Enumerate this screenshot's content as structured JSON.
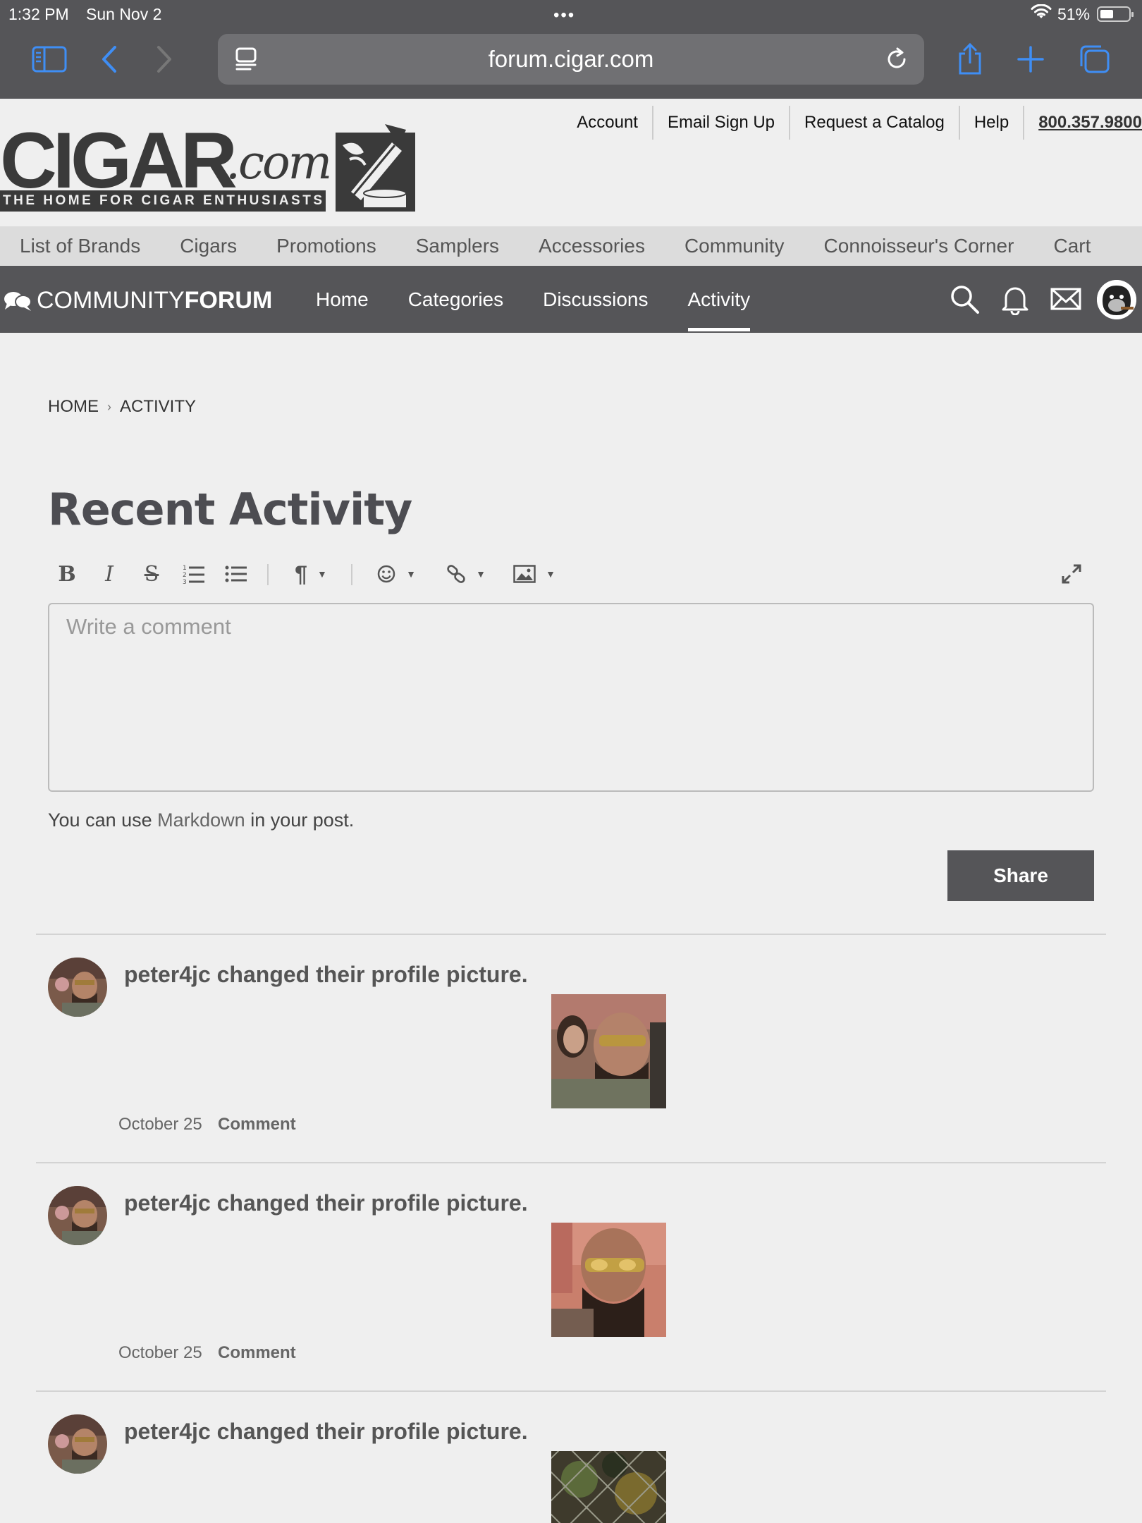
{
  "status_bar": {
    "time": "1:32 PM",
    "date": "Sun Nov 2",
    "battery": "51%"
  },
  "browser": {
    "url": "forum.cigar.com"
  },
  "top_nav": {
    "items": [
      "Account",
      "Email Sign Up",
      "Request a Catalog",
      "Help"
    ],
    "phone": "800.357.9800"
  },
  "logo": {
    "main": "CIGAR",
    "dotcom": ".com",
    "tagline": "THE HOME FOR CIGAR ENTHUSIASTS"
  },
  "main_nav": [
    "List of Brands",
    "Cigars",
    "Promotions",
    "Samplers",
    "Accessories",
    "Community",
    "Connoisseur's Corner",
    "Cart"
  ],
  "forum_bar": {
    "logo_light": "COMMUNITY",
    "logo_bold": "FORUM",
    "nav": [
      "Home",
      "Categories",
      "Discussions",
      "Activity"
    ],
    "active": "Activity"
  },
  "breadcrumb": {
    "home": "HOME",
    "separator": "›",
    "current": "ACTIVITY"
  },
  "page": {
    "title": "Recent Activity"
  },
  "editor": {
    "placeholder": "Write a comment",
    "note_prefix": "You can use ",
    "note_link": "Markdown",
    "note_suffix": " in your post.",
    "share_label": "Share",
    "toolbar": [
      "bold-icon",
      "italic-icon",
      "strikethrough-icon",
      "ordered-list-icon",
      "bullet-list-icon",
      "paragraph-icon",
      "emoji-icon",
      "link-icon",
      "image-icon",
      "fullscreen-icon"
    ]
  },
  "activity": [
    {
      "text": "peter4jc changed their profile picture.",
      "date": "October 25",
      "comment_label": "Comment"
    },
    {
      "text": "peter4jc changed their profile picture.",
      "date": "October 25",
      "comment_label": "Comment"
    },
    {
      "text": "peter4jc changed their profile picture."
    }
  ],
  "colors": {
    "bar": "#555558",
    "background": "#efefef",
    "nav_bg": "#dcdcdc",
    "accent_browser": "#3f8ef5"
  }
}
